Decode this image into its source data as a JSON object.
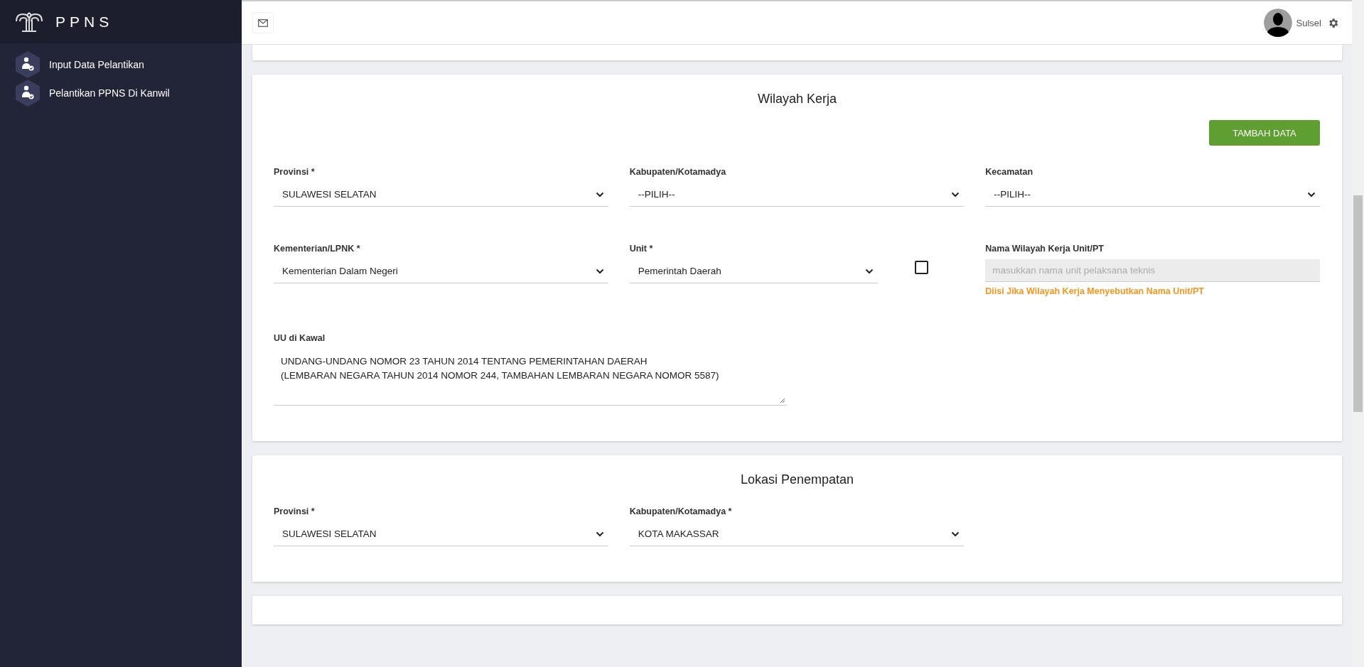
{
  "sidebar": {
    "brand": "PPNS",
    "items": [
      {
        "label": "Input Data Pelantikan",
        "selected": false
      },
      {
        "label": "Pelantikan PPNS Di Kanwil",
        "selected": false
      }
    ]
  },
  "header": {
    "user_name": "Sulsel"
  },
  "sections": [
    {
      "title": "Wilayah Kerja",
      "button": "TAMBAH DATA",
      "rows": [
        [
          {
            "kind": "select",
            "label": "Provinsi *",
            "value": "SULAWESI SELATAN"
          },
          {
            "kind": "select",
            "label": "Kabupaten/Kotamadya",
            "value": "--PILIH--"
          },
          {
            "kind": "select",
            "label": "Kecamatan",
            "value": "--PILIH--"
          }
        ],
        [
          {
            "kind": "select",
            "label": "Kementerian/LPNK *",
            "value": "Kementerian Dalam Negeri"
          },
          {
            "kind": "select",
            "label": "Unit *",
            "value": "Pemerintah Daerah",
            "checkbox": {
              "checked": false
            }
          },
          {
            "kind": "text",
            "label": "Nama Wilayah Kerja Unit/PT",
            "placeholder": "masukkan nama unit pelaksana teknis",
            "disabled": true,
            "help": "Diisi Jika Wilayah Kerja Menyebutkan Nama Unit/PT"
          }
        ],
        [
          {
            "kind": "textarea",
            "label": "UU di Kawal",
            "value": "UNDANG-UNDANG NOMOR 23 TAHUN 2014 TENTANG PEMERINTAHAN DAERAH\n(LEMBARAN NEGARA TAHUN 2014 NOMOR 244, TAMBAHAN LEMBARAN NEGARA NOMOR 5587)"
          }
        ]
      ]
    },
    {
      "title": "Lokasi Penempatan",
      "rows": [
        [
          {
            "kind": "select",
            "label": "Provinsi *",
            "value": "SULAWESI SELATAN"
          },
          {
            "kind": "select",
            "label": "Kabupaten/Kotamadya *",
            "value": "KOTA MAKASSAR"
          }
        ]
      ]
    }
  ]
}
